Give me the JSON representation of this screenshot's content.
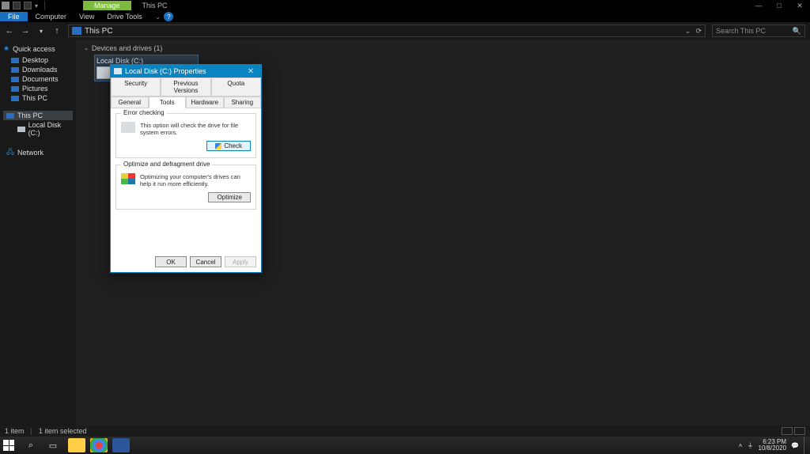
{
  "titlebar": {
    "ribbon_context": "Manage",
    "window_title": "This PC"
  },
  "ribbon": {
    "file": "File",
    "tabs": [
      "Computer",
      "View",
      "Drive Tools"
    ]
  },
  "nav": {
    "address": "This PC",
    "search_placeholder": "Search This PC"
  },
  "sidebar": {
    "quick_access": "Quick access",
    "items": [
      {
        "label": "Desktop"
      },
      {
        "label": "Downloads"
      },
      {
        "label": "Documents"
      },
      {
        "label": "Pictures"
      },
      {
        "label": "This PC"
      }
    ],
    "this_pc": "This PC",
    "local_disk": "Local Disk (C:)",
    "network": "Network"
  },
  "content": {
    "section": "Devices and drives (1)",
    "drive_name": "Local Disk (C:)"
  },
  "dialog": {
    "title": "Local Disk (C:) Properties",
    "tabs_row1": [
      "Security",
      "Previous Versions",
      "Quota"
    ],
    "tabs_row2": [
      "General",
      "Tools",
      "Hardware",
      "Sharing"
    ],
    "error_checking": {
      "title": "Error checking",
      "desc": "This option will check the drive for file system errors.",
      "button": "Check"
    },
    "optimize": {
      "title": "Optimize and defragment drive",
      "desc": "Optimizing your computer's drives can help it run more efficiently.",
      "button": "Optimize"
    },
    "ok": "OK",
    "cancel": "Cancel",
    "apply": "Apply"
  },
  "status": {
    "items": "1 item",
    "selected": "1 item selected"
  },
  "tray": {
    "time": "6:23 PM",
    "date": "10/8/2020"
  }
}
